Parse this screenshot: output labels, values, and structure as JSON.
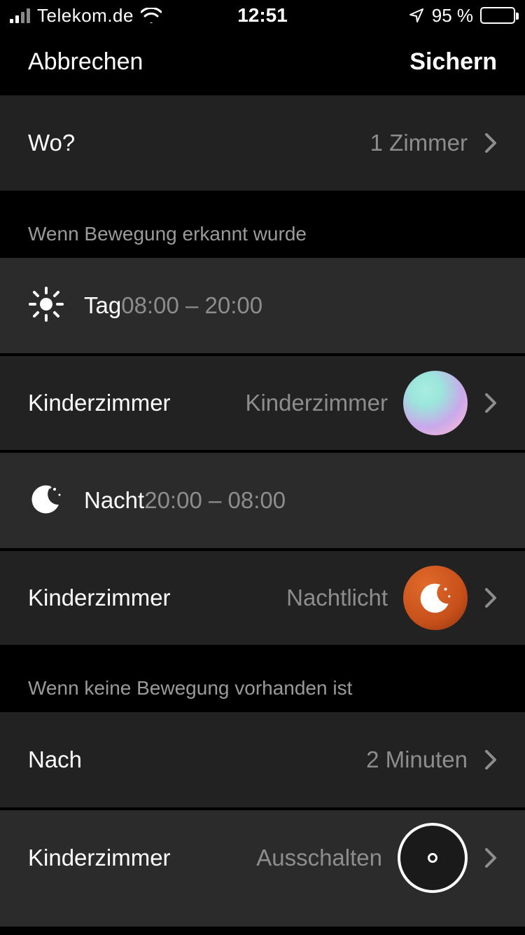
{
  "status": {
    "carrier": "Telekom.de",
    "time": "12:51",
    "battery_pct": "95 %"
  },
  "nav": {
    "cancel": "Abbrechen",
    "save": "Sichern"
  },
  "where": {
    "label": "Wo?",
    "value": "1 Zimmer"
  },
  "motion_header": "Wenn Bewegung erkannt wurde",
  "day": {
    "label": "Tag",
    "range": "08:00 – 20:00",
    "room": "Kinderzimmer",
    "scene": "Kinderzimmer"
  },
  "night": {
    "label": "Nacht",
    "range": "20:00 – 08:00",
    "room": "Kinderzimmer",
    "scene": "Nachtlicht"
  },
  "nomotion_header": "Wenn keine Bewegung vorhanden ist",
  "after": {
    "label": "Nach",
    "value": "2 Minuten"
  },
  "off": {
    "room": "Kinderzimmer",
    "scene": "Ausschalten"
  }
}
